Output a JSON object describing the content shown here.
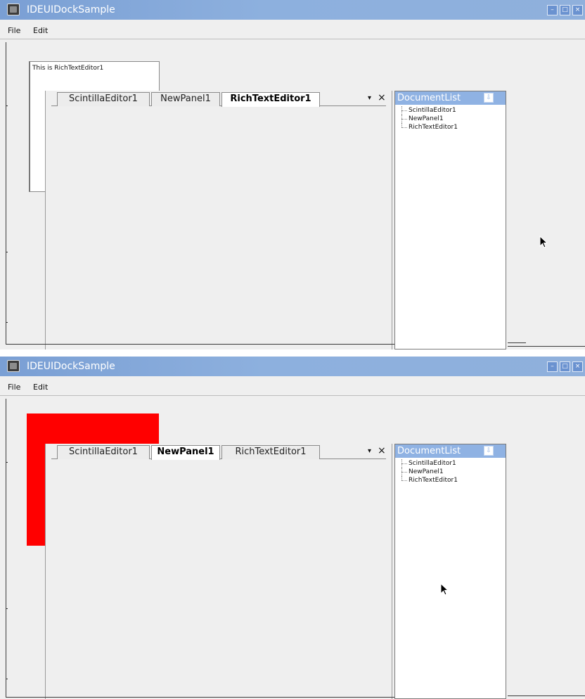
{
  "screens": [
    {
      "window": {
        "title": "IDEUIDockSample"
      },
      "menu": {
        "file": "File",
        "edit": "Edit"
      },
      "floating_panel": {
        "text": "This is RichTextEditor1",
        "visible": true
      },
      "tabs": [
        {
          "label": "ScintillaEditor1",
          "active": false
        },
        {
          "label": "NewPanel1",
          "active": false
        },
        {
          "label": "RichTextEditor1",
          "active": true
        }
      ],
      "tab_controls": {
        "dropdown": "▾",
        "close": "×"
      },
      "document_list": {
        "title": "DocumentList",
        "items": [
          "ScintillaEditor1",
          "NewPanel1",
          "RichTextEditor1"
        ]
      }
    },
    {
      "window": {
        "title": "IDEUIDockSample"
      },
      "menu": {
        "file": "File",
        "edit": "Edit"
      },
      "red_panel": {
        "color": "#ff0000",
        "visible": true
      },
      "tabs": [
        {
          "label": "ScintillaEditor1",
          "active": false
        },
        {
          "label": "NewPanel1",
          "active": true
        },
        {
          "label": "RichTextEditor1",
          "active": false
        }
      ],
      "tab_controls": {
        "dropdown": "▾",
        "close": "×"
      },
      "document_list": {
        "title": "DocumentList",
        "items": [
          "ScintillaEditor1",
          "NewPanel1",
          "RichTextEditor1"
        ]
      }
    }
  ],
  "colors": {
    "titlebar": "#8fb0dc",
    "doclist_header": "#8fb2e3",
    "window_bg": "#efefef",
    "red_panel": "#ff0000"
  },
  "icons": [
    "app-icon",
    "minimize-icon",
    "maximize-icon",
    "close-icon",
    "pin-icon",
    "chevron-down-icon",
    "mouse-cursor-icon"
  ]
}
